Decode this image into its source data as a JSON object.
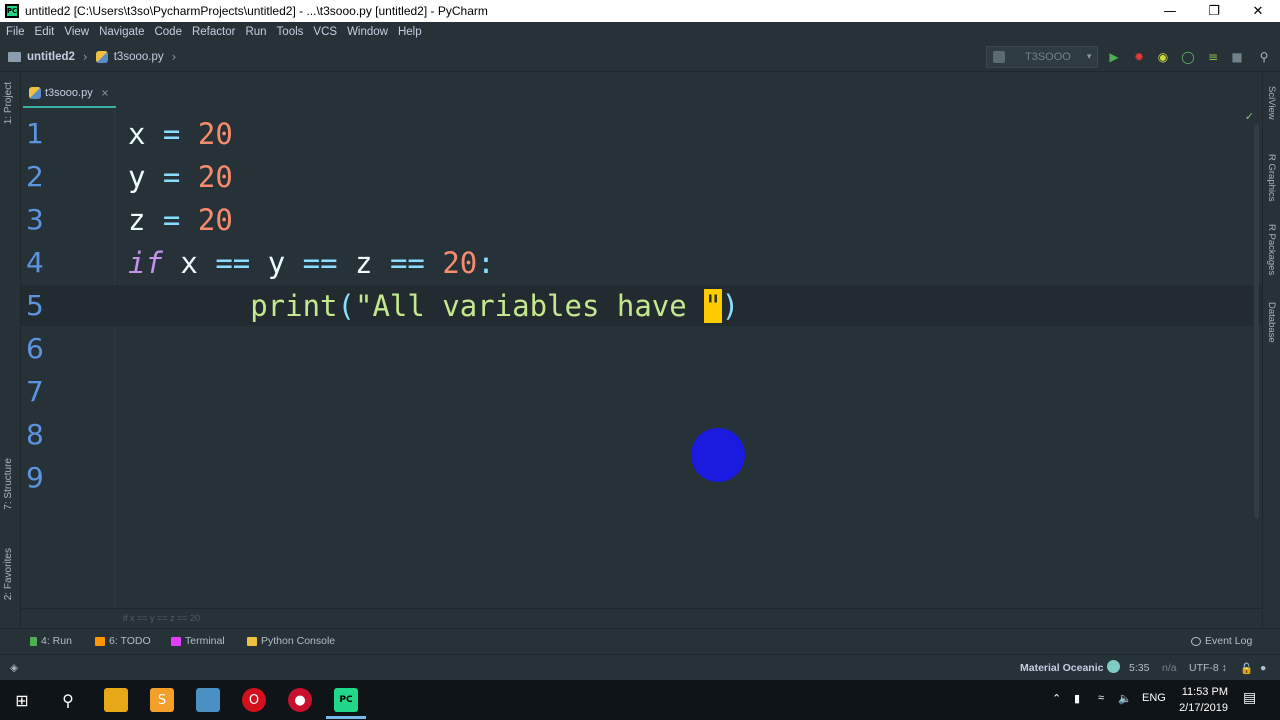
{
  "window": {
    "title": "untitled2 [C:\\Users\\t3so\\PycharmProjects\\untitled2] - ...\\t3sooo.py [untitled2] - PyCharm",
    "minimize": "—",
    "maximize": "❐",
    "close": "✕"
  },
  "menu": {
    "items": [
      "File",
      "Edit",
      "View",
      "Navigate",
      "Code",
      "Refactor",
      "Run",
      "Tools",
      "VCS",
      "Window",
      "Help"
    ]
  },
  "navbar": {
    "project": "untitled2",
    "file": "t3sooo.py",
    "separator": "›"
  },
  "run_config": {
    "label": "T3SOOO",
    "arrow": "▾"
  },
  "left_tabs": {
    "project": "1: Project",
    "structure": "7: Structure",
    "favorites": "2: Favorites"
  },
  "right_tabs": {
    "sciview": "SciView",
    "r_graphics": "R Graphics",
    "r_packages": "R Packages",
    "database": "Database"
  },
  "editor_tab": {
    "label": "t3sooo.py",
    "close": "×"
  },
  "editor": {
    "line_numbers": [
      "1",
      "2",
      "3",
      "4",
      "5",
      "6",
      "7",
      "8",
      "9"
    ],
    "lines": {
      "l1": {
        "var": "x",
        "op": " = ",
        "num": "20"
      },
      "l2": {
        "var": "y",
        "op": " = ",
        "num": "20"
      },
      "l3": {
        "var": "z",
        "op": " = ",
        "num": "20"
      },
      "l4": {
        "kw": "if",
        "sp1": " x ",
        "eq1": "==",
        "sp2": " y ",
        "eq2": "==",
        "sp3": " z ",
        "eq3": "==",
        "sp4": " ",
        "num": "20",
        "colon": ":"
      },
      "l5": {
        "indent": "       ",
        "fn": "print",
        "lparen": "(",
        "str": "\"All variables have ",
        "caret": "\"",
        "rparen": ")"
      }
    },
    "checkmark": "✓",
    "breadcrumb": "if x == y == z == 20"
  },
  "bottom_tools": {
    "run": "4: Run",
    "todo": "6: TODO",
    "terminal": "Terminal",
    "python_console": "Python Console",
    "event_log": "Event Log"
  },
  "status": {
    "theme": "Material Oceanic",
    "position": "5:35",
    "na": "n/a",
    "encoding": "UTF-8 ↕"
  },
  "taskbar": {
    "lang": "ENG",
    "time": "11:53 PM",
    "date": "2/17/2019"
  },
  "colors": {
    "background": "#263238",
    "keyword": "#c792ea",
    "number": "#f78c6c",
    "operator": "#89ddff",
    "string": "#c3e88d",
    "line_number": "#5d94e0",
    "caret": "#ffcc00",
    "click_indicator": "#1b1be0"
  }
}
